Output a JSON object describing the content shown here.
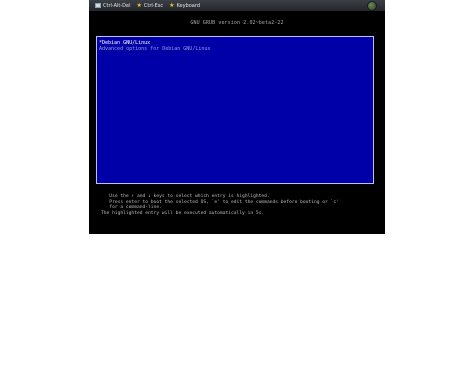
{
  "toolbar": {
    "items": [
      {
        "label": "Ctrl-Alt-Del",
        "icon": "keyboard-icon"
      },
      {
        "label": "Ctrl-Esc",
        "icon": "star-icon"
      },
      {
        "label": "Keyboard",
        "icon": "star-icon"
      }
    ],
    "power_icon": "power-icon"
  },
  "grub": {
    "title": "GNU GRUB  version 2.02~beta2-22",
    "entries": [
      {
        "label": "*Debian GNU/Linux",
        "selected": true
      },
      {
        "label": " Advanced options for Debian GNU/Linux",
        "selected": false
      }
    ],
    "help_lines": [
      "   Use the ↑ and ↓ keys to select which entry is highlighted.",
      "   Press enter to boot the selected OS, `e' to edit the commands before booting or `c'",
      "   for a command-line.",
      "The highlighted entry will be executed automatically in 5s."
    ]
  },
  "colors": {
    "menu_bg": "#0000a8",
    "menu_border": "#bfbfff",
    "selected_text": "#ffffff",
    "normal_text": "#9c9ce0",
    "console_bg": "#000000"
  }
}
